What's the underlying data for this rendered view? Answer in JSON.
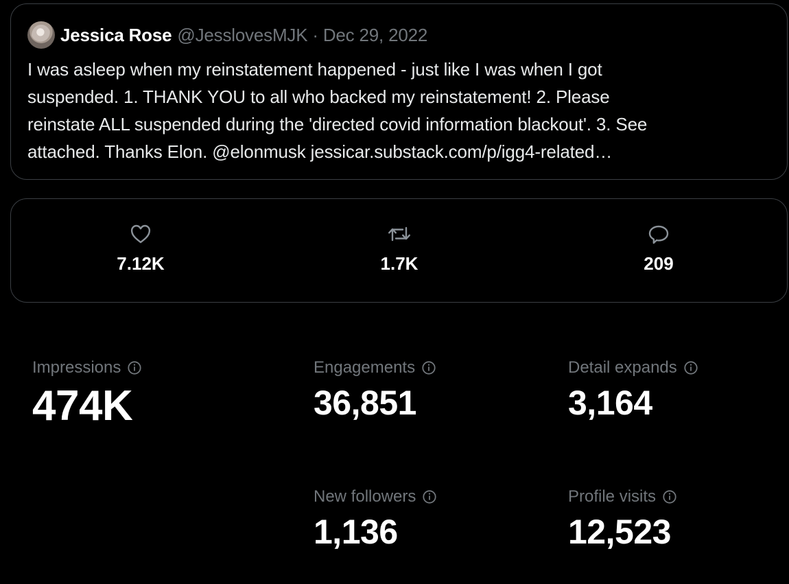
{
  "tweet": {
    "author_name": "Jessica Rose",
    "handle_date": "@JesslovesMJK · Dec 29, 2022",
    "text_lines": [
      "I was asleep when my reinstatement happened - just like I was when I got",
      "suspended. 1. THANK YOU to all who backed my reinstatement! 2. Please",
      "reinstate ALL suspended during the 'directed covid information blackout'. 3. See",
      "attached. Thanks Elon. @elonmusk jessicar.substack.com/p/igg4-related…"
    ]
  },
  "engagement": {
    "likes": "7.12K",
    "retweets": "1.7K",
    "replies": "209",
    "icons": [
      "heart-icon",
      "retweet-icon",
      "reply-icon"
    ]
  },
  "metrics": {
    "impressions": {
      "label": "Impressions",
      "value": "474K"
    },
    "engagements": {
      "label": "Engagements",
      "value": "36,851"
    },
    "detail_expands": {
      "label": "Detail expands",
      "value": "3,164"
    },
    "new_followers": {
      "label": "New followers",
      "value": "1,136"
    },
    "profile_visits": {
      "label": "Profile visits",
      "value": "12,523"
    }
  },
  "colors": {
    "background": "#000000",
    "text_primary": "#ffffff",
    "text_secondary": "#71767b",
    "border": "#3b3f44"
  }
}
